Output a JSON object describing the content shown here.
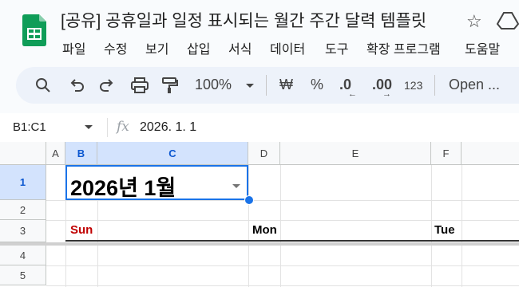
{
  "app": {
    "title": "[공유] 공휴일과 일정 표시되는 월간 주간 달력 템플릿",
    "menu": [
      "파일",
      "수정",
      "보기",
      "삽입",
      "서식",
      "데이터",
      "도구",
      "확장 프로그램",
      "도움말"
    ]
  },
  "toolbar": {
    "zoom": "100%",
    "currency": "₩",
    "percent": "%",
    "dec_decrease": ".0",
    "dec_increase": ".00",
    "number_format": "123",
    "font": "Open ..."
  },
  "formula_bar": {
    "name_box": "B1:C1",
    "fx": "fx",
    "value": "2026. 1. 1"
  },
  "grid": {
    "columns": [
      "A",
      "B",
      "C",
      "D",
      "E",
      "F"
    ],
    "rows": [
      "1",
      "2",
      "3",
      "4",
      "5"
    ],
    "cell_b1": "2026년 1월",
    "days": [
      "Sun",
      "Mon",
      "Tue"
    ]
  },
  "colors": {
    "sun": "#c00000",
    "selection": "#1a73e8",
    "sheets_green": "#0f9d58"
  }
}
